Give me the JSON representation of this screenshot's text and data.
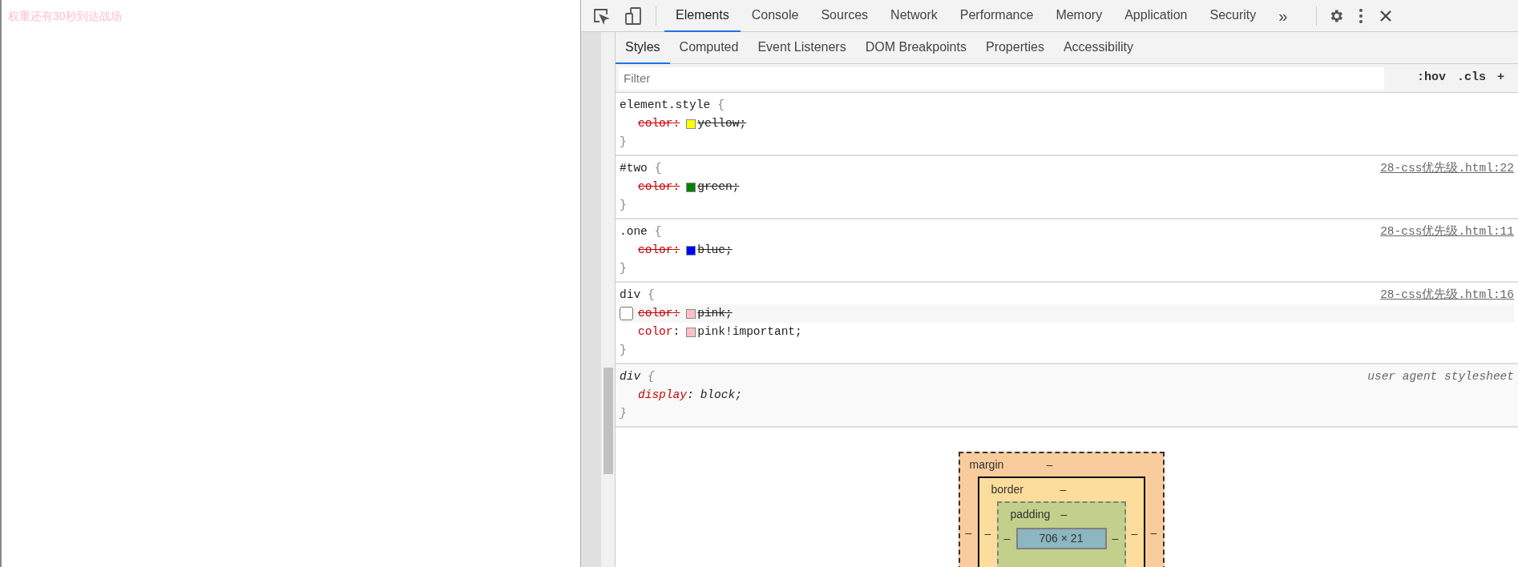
{
  "page": {
    "text": "权重还有30秒到达战场"
  },
  "toolbar": {
    "tabs": [
      {
        "label": "Elements",
        "selected": true
      },
      {
        "label": "Console",
        "selected": false
      },
      {
        "label": "Sources",
        "selected": false
      },
      {
        "label": "Network",
        "selected": false
      },
      {
        "label": "Performance",
        "selected": false
      },
      {
        "label": "Memory",
        "selected": false
      },
      {
        "label": "Application",
        "selected": false
      },
      {
        "label": "Security",
        "selected": false
      }
    ],
    "more": "»"
  },
  "subtabs": [
    {
      "label": "Styles",
      "selected": true
    },
    {
      "label": "Computed",
      "selected": false
    },
    {
      "label": "Event Listeners",
      "selected": false
    },
    {
      "label": "DOM Breakpoints",
      "selected": false
    },
    {
      "label": "Properties",
      "selected": false
    },
    {
      "label": "Accessibility",
      "selected": false
    }
  ],
  "filter": {
    "placeholder": "Filter",
    "buttons": [
      ":hov",
      ".cls",
      "+"
    ]
  },
  "rules": [
    {
      "kind": "author",
      "selector": "element.style",
      "open": "{",
      "close": "}",
      "properties": [
        {
          "name": "color",
          "separator": ":",
          "value": "yellow;",
          "overridden": true,
          "hovered": false,
          "color": "#ffff00"
        }
      ]
    },
    {
      "kind": "author",
      "selector": "#two",
      "open": "{",
      "close": "}",
      "source": "28-css优先级.html:22",
      "properties": [
        {
          "name": "color",
          "separator": ":",
          "value": "green;",
          "overridden": true,
          "hovered": false,
          "color": "#008000"
        }
      ]
    },
    {
      "kind": "author",
      "selector": ".one",
      "open": "{",
      "close": "}",
      "source": "28-css优先级.html:11",
      "properties": [
        {
          "name": "color",
          "separator": ":",
          "value": "blue;",
          "overridden": true,
          "hovered": false,
          "color": "#0000ff"
        }
      ]
    },
    {
      "kind": "author",
      "selector": "div",
      "open": "{",
      "close": "}",
      "source": "28-css优先级.html:16",
      "properties": [
        {
          "name": "color",
          "separator": ":",
          "value": "pink;",
          "overridden": true,
          "hovered": true,
          "color": "#ffc0cb"
        },
        {
          "name": "color",
          "separator": ":",
          "value": "pink!important;",
          "overridden": false,
          "hovered": false,
          "color": "#ffc0cb"
        }
      ]
    },
    {
      "kind": "user-agent",
      "selector": "div",
      "open": "{",
      "close": "}",
      "source": "user agent stylesheet",
      "properties": [
        {
          "name": "display",
          "separator": ":",
          "value": "block;",
          "overridden": false,
          "hovered": false
        }
      ]
    }
  ],
  "box_model": {
    "margin": {
      "label": "margin",
      "top": "–",
      "left": "–",
      "right": "–"
    },
    "border": {
      "label": "border",
      "top": "–",
      "left": "–",
      "right": "–"
    },
    "padding": {
      "label": "padding",
      "top": "–",
      "left": "–",
      "right": "–"
    },
    "content": "706 × 21"
  }
}
